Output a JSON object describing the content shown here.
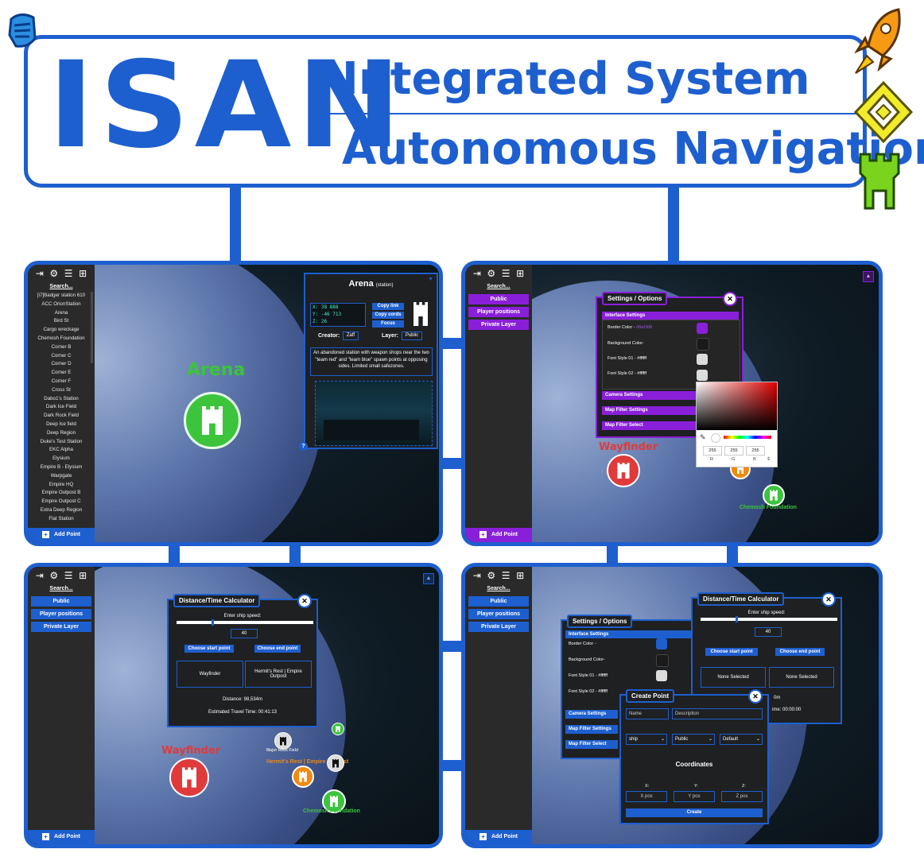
{
  "banner": {
    "acronym": "ISAN",
    "line1": "Integrated System",
    "line2": "Autonomous Navigation"
  },
  "panel1": {
    "search": "Search...",
    "items": [
      "[i7]Badger station 610",
      "ACC OrionStation",
      "Arena",
      "Bird St",
      "Cargo wreckage",
      "Chemosh Foundation",
      "Corner B",
      "Corner C",
      "Corner D",
      "Corner E",
      "Corner F",
      "Cross St",
      "Dabo1's Station",
      "Dark Ice Field",
      "Dark Rock Field",
      "Deep Ice field",
      "Deep Region",
      "Duke's Test Station",
      "EKC Alpha",
      "Elysium",
      "Empire B - Elysium Warpgate",
      "Empire HQ",
      "Empire Outpost B",
      "Empire Outpost C",
      "Extra Deep Region",
      "Flat Station"
    ],
    "add_point": "Add Point",
    "marker_label": "Arena",
    "info": {
      "title": "Arena",
      "type": "(station)",
      "coords": [
        "X: 38 888",
        "Y: -46 713",
        "Z: 26"
      ],
      "copy_link": "Copy link",
      "copy_cords": "Copy cords",
      "focus": "Focus",
      "creator_label": "Creator:",
      "creator": "Zaff",
      "layer_label": "Layer:",
      "layer": "Public",
      "description": "An abandoned station with weapon shops near the two \"team red\" and \"team blue\" spawn points at opposing sides. Limited small safezones.",
      "help": "?"
    }
  },
  "panel2": {
    "search": "Search...",
    "layers": [
      "Public",
      "Player positions",
      "Private Layer"
    ],
    "add_point": "Add Point",
    "settings_title": "Settings / Options",
    "interface_settings": "Interface Settings",
    "rows": [
      "Border Color - ",
      "Background Color-",
      "Font Style 01 - #ffffff",
      "Font Style 02 - #ffffff"
    ],
    "sections": [
      "Camera Settings",
      "Map Filter Settings",
      "Map Filter Select"
    ],
    "rgb_values": [
      "255",
      "255",
      "255"
    ],
    "rgb_labels": [
      "R",
      "G",
      "B"
    ],
    "map_labels": [
      "Wayfinder",
      "Chemosh Foundation"
    ],
    "colors": {
      "accent": "#8a1fd9"
    }
  },
  "panel3": {
    "search": "Search...",
    "layers": [
      "Public",
      "Player positions",
      "Private Layer"
    ],
    "add_point": "Add Point",
    "calc_title": "Distance/Time Calculator",
    "speed_label": "Enter ship speed:",
    "speed": "40",
    "choose_start": "Choose start point",
    "choose_end": "Choose end point",
    "start": "Wayfinder",
    "end": "Hermit's Rest | Empire Outpost",
    "distance": "Distance: 98,534m",
    "travel_time": "Estimated Travel Time: 00:41:13",
    "map_labels": [
      "Wayfinder",
      "Hermit's Rest | Empire Outpost",
      "Chemosh Foundation",
      "Major Rock Field"
    ]
  },
  "panel4": {
    "search": "Search...",
    "layers": [
      "Public",
      "Player positions",
      "Private Layer"
    ],
    "add_point": "Add Point",
    "settings_title": "Settings / Options",
    "interface_settings": "Interface Settings",
    "rows": [
      "Border Color - ",
      "Background Color-",
      "Font Style 01 - #ffffff",
      "Font Style 02 - #ffffff"
    ],
    "sections": [
      "Camera Settings",
      "Map Filter Settings",
      "Map Filter Select"
    ],
    "calc_title": "Distance/Time Calculator",
    "speed_label": "Enter ship speed:",
    "speed": "40",
    "choose_start": "Choose start point",
    "choose_end": "Choose end point",
    "none_selected": "None Selected",
    "distance_frag": "0m",
    "time_frag": "ime: 00:00:00",
    "create_title": "Create Point",
    "name_ph": "Name",
    "desc_ph": "Description",
    "type": "ship",
    "layer": "Public",
    "style": "Default",
    "coordinates": "Coordinates",
    "x_label": "X:",
    "y_label": "Y:",
    "z_label": "Z:",
    "x_ph": "X pos",
    "y_ph": "Y pos",
    "z_ph": "Z pos",
    "create": "Create"
  }
}
